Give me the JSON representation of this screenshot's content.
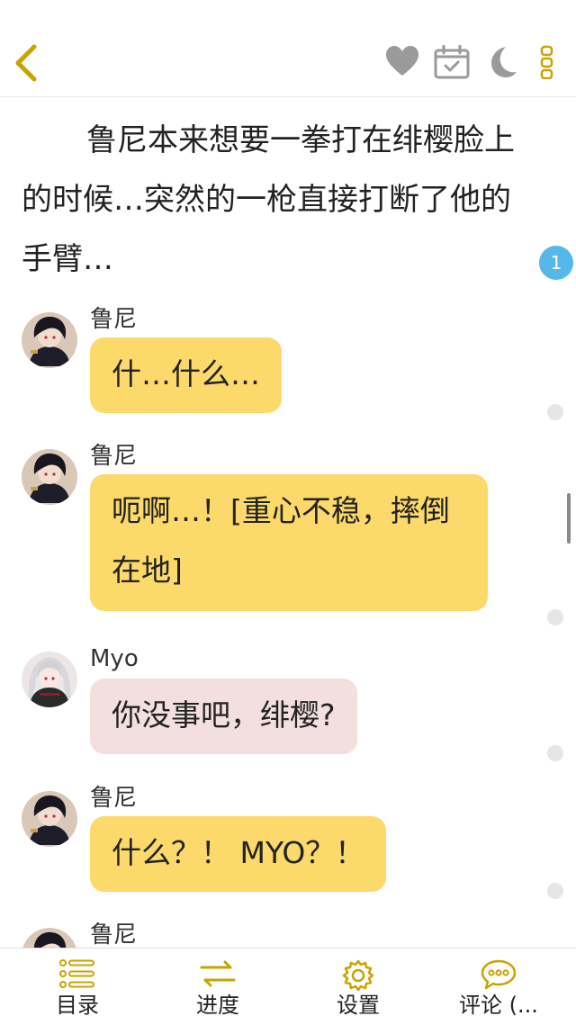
{
  "colors": {
    "accent": "#c9a300",
    "bubble_yellow": "#fbd96a",
    "bubble_pink": "#f4dfe0",
    "badge": "#55b8e8",
    "icon_gray": "#9a9a9a"
  },
  "topbar": {
    "back_icon": "chevron-left-icon",
    "actions": [
      "heart-icon",
      "calendar-check-icon",
      "moon-icon",
      "more-vertical-icon"
    ]
  },
  "narration": {
    "text": "鲁尼本来想要一拳打在绯樱脸上的时候…突然的一枪直接打断了他的手臂…",
    "comment_count": "1"
  },
  "messages": [
    {
      "speaker": "鲁尼",
      "text": "什…什么…",
      "style": "yellow",
      "avatar": "dark-haired-boy-avatar"
    },
    {
      "speaker": "鲁尼",
      "text": "呃啊…！[重心不稳，摔倒在地]",
      "style": "yellow",
      "avatar": "dark-haired-boy-avatar"
    },
    {
      "speaker": "Myo",
      "text": "你没事吧，绯樱?",
      "style": "pink",
      "avatar": "silver-haired-girl-avatar"
    },
    {
      "speaker": "鲁尼",
      "text": "什么？！ MYO？！",
      "style": "yellow",
      "avatar": "dark-haired-boy-avatar"
    },
    {
      "speaker": "鲁尼",
      "text": "",
      "style": "yellow",
      "avatar": "dark-haired-boy-avatar"
    }
  ],
  "bottom_nav": [
    {
      "label": "目录",
      "icon": "list-icon"
    },
    {
      "label": "进度",
      "icon": "swap-arrows-icon"
    },
    {
      "label": "设置",
      "icon": "gear-icon"
    },
    {
      "label": "评论 (...",
      "icon": "chat-bubble-icon"
    }
  ]
}
